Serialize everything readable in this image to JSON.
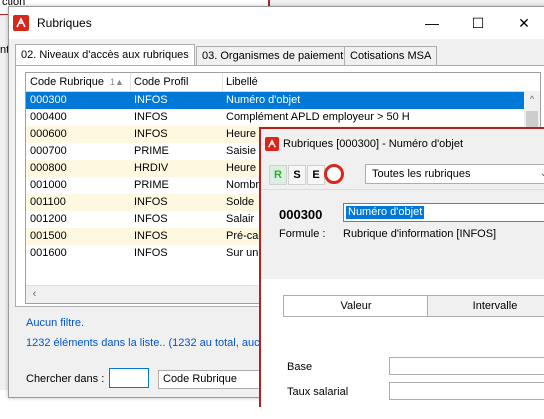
{
  "background": {
    "frag1": "ction",
    "frag2": "nt"
  },
  "main_window": {
    "title": "Rubriques",
    "tabs": [
      "02. Niveaux d'accès aux rubriques",
      "03. Organismes de paiement",
      "Cotisations MSA"
    ],
    "columns": [
      "Code Rubrique",
      "Code Profil",
      "Libellé"
    ],
    "sort_indicator": "1▲",
    "rows": [
      {
        "code": "000300",
        "profil": "INFOS",
        "libelle": "Numéro d'objet"
      },
      {
        "code": "000400",
        "profil": "INFOS",
        "libelle": "Complément APLD employeur > 50 H"
      },
      {
        "code": "000600",
        "profil": "INFOS",
        "libelle": "Heure"
      },
      {
        "code": "000700",
        "profil": "PRIME",
        "libelle": "Saisie"
      },
      {
        "code": "000800",
        "profil": "HRDIV",
        "libelle": "Heure"
      },
      {
        "code": "001000",
        "profil": "PRIME",
        "libelle": "Nombr"
      },
      {
        "code": "001100",
        "profil": "INFOS",
        "libelle": "Solde"
      },
      {
        "code": "001200",
        "profil": "INFOS",
        "libelle": "Salair"
      },
      {
        "code": "001500",
        "profil": "INFOS",
        "libelle": "Pré-ca"
      },
      {
        "code": "001600",
        "profil": "INFOS",
        "libelle": "Sur un"
      }
    ],
    "filter_text": "Aucun filtre.",
    "count_text": "1232 éléments dans la liste.. (1232 au total, auc",
    "search_label": "Chercher dans :",
    "search_value": "",
    "search_field": "Code Rubrique"
  },
  "detail_window": {
    "title": "Rubriques [000300] - Numéro d'objet",
    "toolbar_buttons": [
      "R",
      "S",
      "E"
    ],
    "filter_combo": "Toutes les rubriques",
    "code": "000300",
    "libelle_value": "Numéro d'objet",
    "formula_label": "Formule :",
    "formula_value": "Rubrique d'information [INFOS]",
    "subtabs": [
      "Valeur",
      "Intervalle"
    ],
    "fields": [
      "Base",
      "Taux salarial"
    ]
  },
  "colors": {
    "selection": "#0078d7",
    "alt_row": "#fff8e1",
    "accent_red": "#b22222",
    "link_blue": "#0055cc"
  }
}
